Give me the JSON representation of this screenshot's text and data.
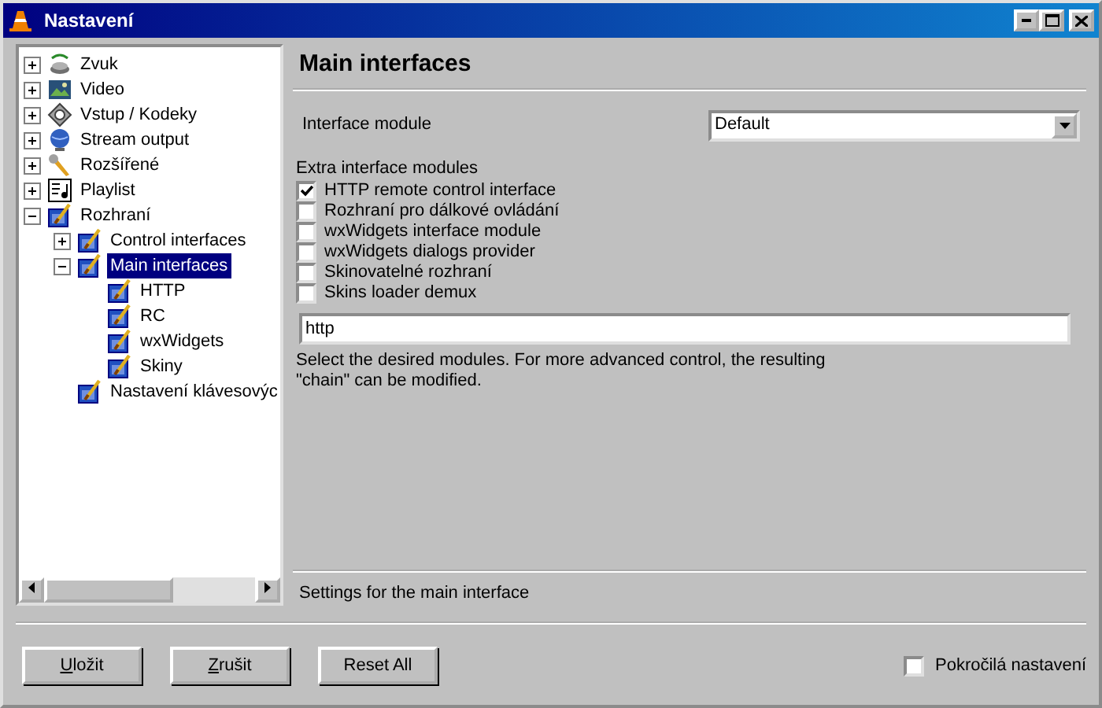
{
  "window": {
    "title": "Nastavení"
  },
  "tree": [
    {
      "label": "Zvuk",
      "kind": "sound",
      "expanded": false,
      "selected": false
    },
    {
      "label": "Video",
      "kind": "video",
      "expanded": false,
      "selected": false
    },
    {
      "label": "Vstup / Kodeky",
      "kind": "input",
      "expanded": false,
      "selected": false
    },
    {
      "label": "Stream output",
      "kind": "stream",
      "expanded": false,
      "selected": false
    },
    {
      "label": "Rozšířené",
      "kind": "advanced",
      "expanded": false,
      "selected": false
    },
    {
      "label": "Playlist",
      "kind": "playlist",
      "expanded": false,
      "selected": false
    },
    {
      "label": "Rozhraní",
      "kind": "interface",
      "expanded": true,
      "selected": false,
      "children": [
        {
          "label": "Control interfaces",
          "kind": "interface",
          "expanded": false,
          "selected": false
        },
        {
          "label": "Main interfaces",
          "kind": "interface",
          "expanded": true,
          "selected": true,
          "children": [
            {
              "label": "HTTP",
              "kind": "interface",
              "selected": false
            },
            {
              "label": "RC",
              "kind": "interface",
              "selected": false
            },
            {
              "label": "wxWidgets",
              "kind": "interface",
              "selected": false
            },
            {
              "label": "Skiny",
              "kind": "interface",
              "selected": false
            }
          ]
        },
        {
          "label": "Nastavení klávesovýc",
          "kind": "interface",
          "selected": false
        }
      ]
    }
  ],
  "panel": {
    "title": "Main interfaces",
    "interface_module": {
      "label": "Interface module",
      "value": "Default"
    },
    "extra_label": "Extra interface modules",
    "modules": [
      {
        "label": "HTTP remote control interface",
        "checked": true
      },
      {
        "label": "Rozhraní pro dálkové ovládání",
        "checked": false
      },
      {
        "label": "wxWidgets interface module",
        "checked": false
      },
      {
        "label": "wxWidgets dialogs provider",
        "checked": false
      },
      {
        "label": "Skinovatelné rozhraní",
        "checked": false
      },
      {
        "label": "Skins loader demux",
        "checked": false
      }
    ],
    "chain_value": "http",
    "help": "Select the desired modules. For more advanced control, the resulting\n\"chain\" can be modified.",
    "status": "Settings for the main interface"
  },
  "buttons": [
    {
      "label": "Uložit",
      "underline_first": true
    },
    {
      "label": "Zrušit",
      "underline_first": true
    },
    {
      "label": "Reset All",
      "underline_first": false
    }
  ],
  "advanced": {
    "label": "Pokročilá nastavení",
    "checked": false
  }
}
